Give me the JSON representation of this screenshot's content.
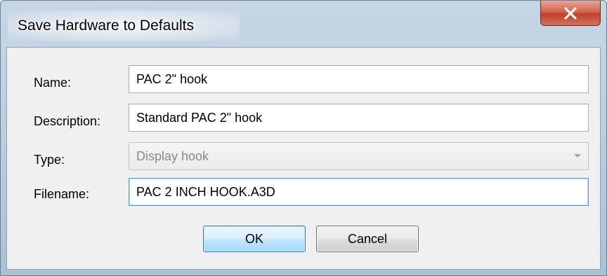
{
  "window": {
    "title": "Save Hardware to Defaults",
    "close_icon": "close-x-icon"
  },
  "form": {
    "name_label": "Name:",
    "name_value": "PAC 2\" hook",
    "description_label": "Description:",
    "description_value": "Standard PAC 2\" hook",
    "type_label": "Type:",
    "type_value": "Display hook",
    "type_disabled": true,
    "filename_label": "Filename:",
    "filename_value": "PAC 2 INCH HOOK.A3D"
  },
  "buttons": {
    "ok_label": "OK",
    "cancel_label": "Cancel"
  },
  "colors": {
    "close_button": "#c2402b",
    "ok_button_border": "#3c7fb1",
    "focus_border": "#5a9bd5"
  }
}
